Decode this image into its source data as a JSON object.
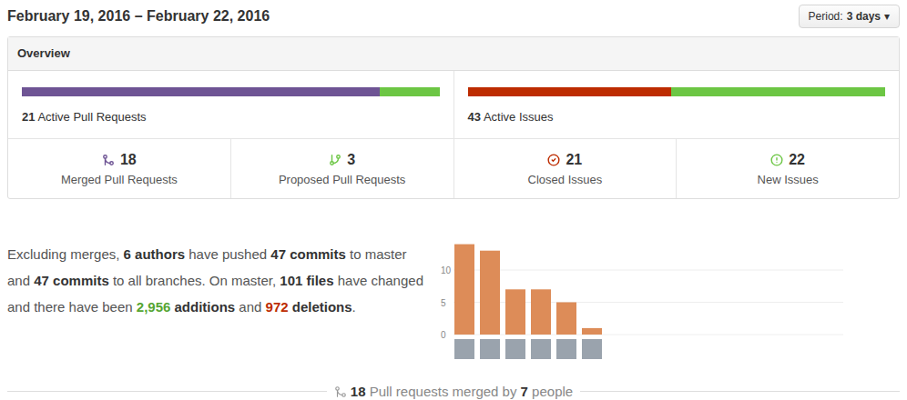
{
  "header": {
    "title": "February 19, 2016 – February 22, 2016",
    "period": {
      "label": "Period:",
      "value": "3 days",
      "caret": "▾"
    }
  },
  "overview": {
    "title": "Overview",
    "pull_requests": {
      "count": "21",
      "label": "Active Pull Requests",
      "level": 0.857
    },
    "issues": {
      "count": "43",
      "label": "Active Issues",
      "level": 0.488
    },
    "stats": [
      {
        "count": "18",
        "label": "Merged Pull Requests",
        "kind": "merged",
        "color": "#6e5494"
      },
      {
        "count": "3",
        "label": "Proposed Pull Requests",
        "kind": "proposed",
        "color": "#6cc644"
      },
      {
        "count": "21",
        "label": "Closed Issues",
        "kind": "closed",
        "color": "#bd2c00"
      },
      {
        "count": "22",
        "label": "New Issues",
        "kind": "new",
        "color": "#6cc644"
      }
    ]
  },
  "summary": [
    {
      "text": "Excluding merges, ",
      "kind": "plain"
    },
    {
      "text": "6 authors",
      "kind": "bold"
    },
    {
      "text": " have pushed ",
      "kind": "plain"
    },
    {
      "text": "47 commits",
      "kind": "bold"
    },
    {
      "text": " to master and ",
      "kind": "plain"
    },
    {
      "text": "47 commits",
      "kind": "bold"
    },
    {
      "text": " to all branches. On master, ",
      "kind": "plain"
    },
    {
      "text": "101 files",
      "kind": "bold"
    },
    {
      "text": " have changed and there have been ",
      "kind": "plain"
    },
    {
      "text": "2,956",
      "kind": "additions"
    },
    {
      "text": " additions",
      "kind": "bold"
    },
    {
      "text": " and ",
      "kind": "plain"
    },
    {
      "text": "972",
      "kind": "deletions"
    },
    {
      "text": " deletions",
      "kind": "bold"
    },
    {
      "text": ".",
      "kind": "plain"
    }
  ],
  "chart": {
    "ticks": [
      {
        "label": "0",
        "value": 0
      },
      {
        "label": "5",
        "value": 5
      },
      {
        "label": "10",
        "value": 10
      }
    ],
    "series": [
      {
        "name": "commits",
        "values": [
          14,
          13,
          7,
          7,
          5,
          1
        ]
      }
    ]
  },
  "footer": [
    {
      "text": "18",
      "kind": "bold"
    },
    {
      "text": " Pull requests merged by ",
      "kind": "plain"
    },
    {
      "text": "7",
      "kind": "bold"
    },
    {
      "text": " people",
      "kind": "plain"
    }
  ]
}
